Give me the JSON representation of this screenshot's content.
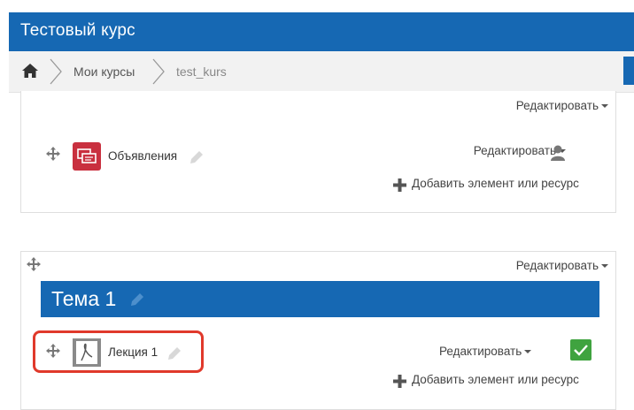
{
  "header": {
    "title": "Тестовый курс"
  },
  "breadcrumb": {
    "items": [
      "Мои курсы",
      "test_kurs"
    ]
  },
  "section0": {
    "edit_label": "Редактировать",
    "activity": {
      "name": "Объявления",
      "edit_label": "Редактировать",
      "add_label": "Добавить элемент или ресурс"
    }
  },
  "section1": {
    "edit_label": "Редактировать",
    "title": "Тема 1",
    "activity": {
      "name": "Лекция 1",
      "edit_label": "Редактировать",
      "add_label": "Добавить элемент или ресурс",
      "completed": true
    }
  },
  "colors": {
    "brand": "#1668b3",
    "highlight": "#e0392b",
    "forum_icon": "#c9303f",
    "complete": "#3fa33f"
  }
}
